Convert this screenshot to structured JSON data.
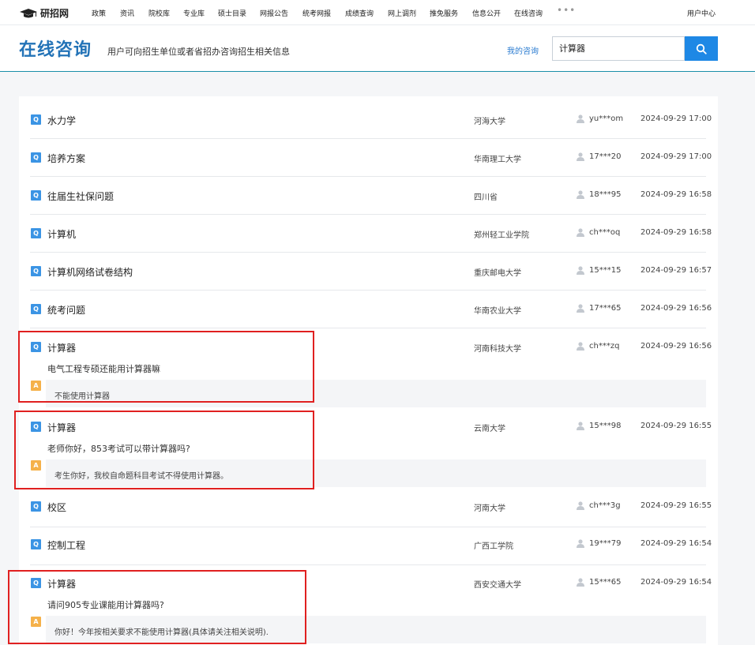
{
  "nav": {
    "logo_text": "研招网",
    "items": [
      "政策",
      "资讯",
      "院校库",
      "专业库",
      "硕士目录",
      "网报公告",
      "统考网报",
      "成绩查询",
      "网上调剂",
      "推免服务",
      "信息公开",
      "在线咨询"
    ],
    "more": "•••",
    "user_center": "用户中心"
  },
  "header": {
    "title": "在线咨询",
    "subtitle": "用户可向招生单位或者省招办咨询招生相关信息",
    "my_consult": "我的咨询",
    "search_value": "计算器",
    "search_icon": "search-icon"
  },
  "badges": {
    "q": "Q",
    "a": "A"
  },
  "colors": {
    "accent": "#1e88e5",
    "title": "#2373b7",
    "q_badge": "#3b94e4",
    "a_badge": "#f5b14a",
    "highlight": "#e02020"
  },
  "questions": [
    {
      "title": "水力学",
      "school": "河海大学",
      "user": "yu***om",
      "time": "2024-09-29 17:00"
    },
    {
      "title": "培养方案",
      "school": "华南理工大学",
      "user": "17***20",
      "time": "2024-09-29 17:00"
    },
    {
      "title": "往届生社保问题",
      "school": "四川省",
      "user": "18***95",
      "time": "2024-09-29 16:58"
    },
    {
      "title": "计算机",
      "school": "郑州轻工业学院",
      "user": "ch***oq",
      "time": "2024-09-29 16:58"
    },
    {
      "title": "计算机网络试卷结构",
      "school": "重庆邮电大学",
      "user": "15***15",
      "time": "2024-09-29 16:57"
    },
    {
      "title": "统考问题",
      "school": "华南农业大学",
      "user": "17***65",
      "time": "2024-09-29 16:56"
    },
    {
      "title": "计算器",
      "school": "河南科技大学",
      "user": "ch***zq",
      "time": "2024-09-29 16:56",
      "body": "电气工程专硕还能用计算器嘛",
      "answer": "不能使用计算器"
    },
    {
      "title": "计算器",
      "school": "云南大学",
      "user": "15***98",
      "time": "2024-09-29 16:55",
      "body": "老师你好，853考试可以带计算器吗?",
      "answer": "考生你好，我校自命题科目考试不得使用计算器。"
    },
    {
      "title": "校区",
      "school": "河南大学",
      "user": "ch***3g",
      "time": "2024-09-29 16:55"
    },
    {
      "title": "控制工程",
      "school": "广西工学院",
      "user": "19***79",
      "time": "2024-09-29 16:54"
    },
    {
      "title": "计算器",
      "school": "西安交通大学",
      "user": "15***65",
      "time": "2024-09-29 16:54",
      "body": "请问905专业课能用计算器吗?",
      "answer": "你好！今年按相关要求不能使用计算器(具体请关注相关说明)."
    }
  ]
}
